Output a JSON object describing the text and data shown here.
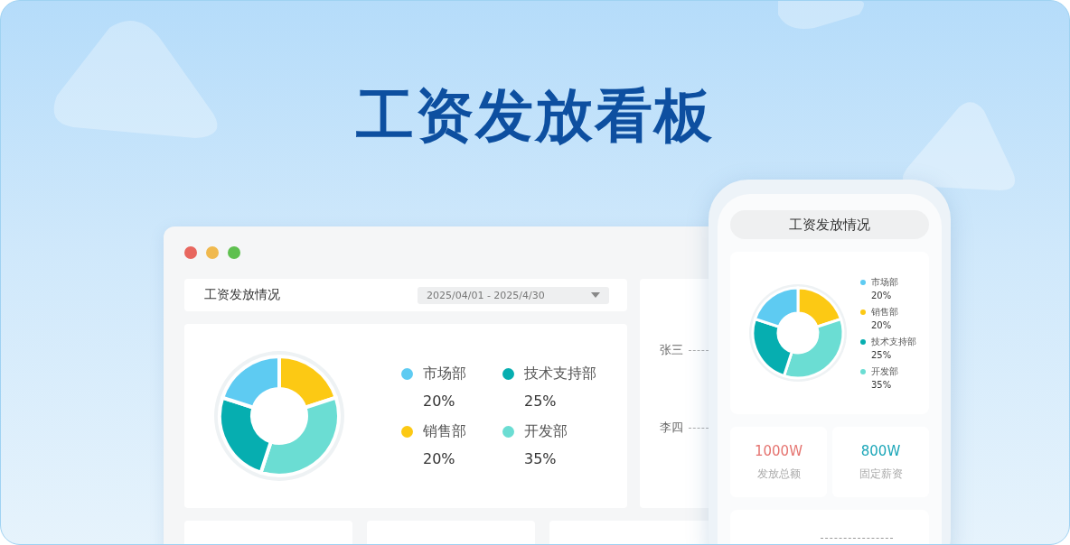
{
  "page_title": "工资发放看板",
  "desktop": {
    "window_controls": [
      {
        "color": "#e8675f"
      },
      {
        "color": "#f0b94e"
      },
      {
        "color": "#5fc050"
      }
    ],
    "header": {
      "title": "工资发放情况",
      "date_range": "2025/04/01 - 2025/4/30"
    },
    "chart_data": {
      "type": "donut",
      "values": [
        20,
        35,
        25,
        20
      ],
      "colors": [
        "#fcc914",
        "#6bddd3",
        "#06aeb0",
        "#5ecbf2"
      ]
    },
    "legend": [
      {
        "label": "市场部",
        "value": "20%",
        "color": "#5ecbf2"
      },
      {
        "label": "销售部",
        "value": "20%",
        "color": "#fcc914"
      },
      {
        "label": "技术支持部",
        "value": "25%",
        "color": "#06aeb0"
      },
      {
        "label": "开发部",
        "value": "35%",
        "color": "#6bddd3"
      }
    ],
    "people": [
      {
        "name": "张三"
      },
      {
        "name": "李四"
      }
    ]
  },
  "phone": {
    "header_title": "工资发放情况",
    "chart_data": {
      "type": "donut",
      "values": [
        20,
        35,
        25,
        20
      ],
      "colors": [
        "#fcc914",
        "#6bddd3",
        "#06aeb0",
        "#5ecbf2"
      ]
    },
    "legend": [
      {
        "label": "市场部",
        "value": "20%",
        "color": "#5ecbf2"
      },
      {
        "label": "销售部",
        "value": "20%",
        "color": "#fcc914"
      },
      {
        "label": "技术支持部",
        "value": "25%",
        "color": "#06aeb0"
      },
      {
        "label": "开发部",
        "value": "35%",
        "color": "#6bddd3"
      }
    ],
    "stats": [
      {
        "value": "1000W",
        "label": "发放总额",
        "color": "#e5736f"
      },
      {
        "value": "800W",
        "label": "固定薪资",
        "color": "#1ba6b8"
      }
    ]
  }
}
